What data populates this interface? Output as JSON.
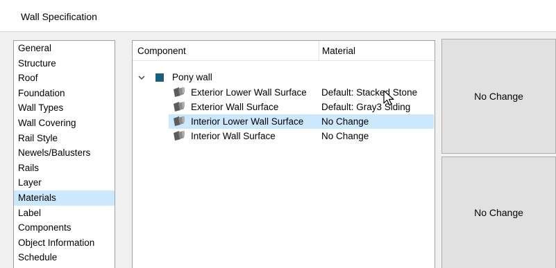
{
  "window": {
    "title": "Wall Specification"
  },
  "nav": {
    "items": [
      "General",
      "Structure",
      "Roof",
      "Foundation",
      "Wall Types",
      "Wall Covering",
      "Rail Style",
      "Newels/Balusters",
      "Rails",
      "Layer",
      "Materials",
      "Label",
      "Components",
      "Object Information",
      "Schedule"
    ],
    "selected": "Materials"
  },
  "tree": {
    "headers": {
      "component": "Component",
      "material": "Material"
    },
    "root": {
      "label": "Pony wall"
    },
    "rows": [
      {
        "component": "Exterior Lower Wall Surface",
        "material": "Default: Stacked Stone"
      },
      {
        "component": "Exterior Wall Surface",
        "material": "Default: Gray3 Siding"
      },
      {
        "component": "Interior Lower Wall Surface",
        "material": "No Change",
        "selected": true
      },
      {
        "component": "Interior Wall Surface",
        "material": "No Change"
      }
    ]
  },
  "swatches": {
    "top": "No Change",
    "bottom": "No Change"
  },
  "colors": {
    "selection": "#cce8ff",
    "root_icon": "#1d5f7b",
    "panel_bg": "#f0f0f0",
    "swatch_bg": "#e1e1e1"
  }
}
